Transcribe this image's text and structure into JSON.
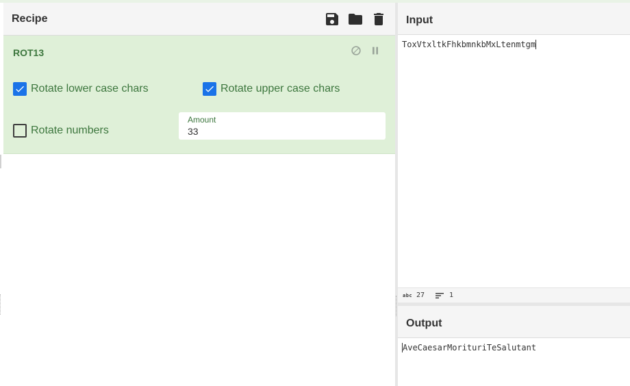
{
  "recipe": {
    "title": "Recipe",
    "icons": [
      "save-icon",
      "folder-icon",
      "trash-icon"
    ]
  },
  "operation": {
    "name": "ROT13",
    "controls": [
      "disable-icon",
      "pause-icon"
    ],
    "rotate_lower": {
      "label": "Rotate lower case chars",
      "checked": true
    },
    "rotate_upper": {
      "label": "Rotate upper case chars",
      "checked": true
    },
    "rotate_numbers": {
      "label": "Rotate numbers",
      "checked": false
    },
    "amount": {
      "label": "Amount",
      "value": "33"
    }
  },
  "input": {
    "title": "Input",
    "text": "ToxVtxltkFhkbmnkbMxLtenmtgm",
    "status": {
      "abc_icon": "abc",
      "length": "27",
      "lines": "1"
    }
  },
  "output": {
    "title": "Output",
    "text": "AveCaesarMorituriTeSalutant"
  },
  "colors": {
    "operation_bg": "#dff0d8",
    "operation_text": "#3c763d",
    "checkbox_checked": "#1a73e8",
    "header_bg": "#f5f5f5"
  }
}
